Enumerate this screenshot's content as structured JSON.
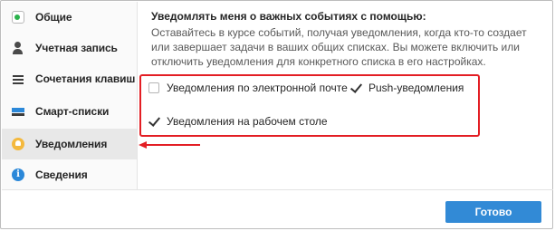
{
  "sidebar": {
    "items": [
      {
        "label": "Общие",
        "icon": "toggle-icon"
      },
      {
        "label": "Учетная запись",
        "icon": "user-icon"
      },
      {
        "label": "Сочетания клавиш",
        "icon": "keyboard-icon"
      },
      {
        "label": "Смарт-списки",
        "icon": "smart-list-icon"
      },
      {
        "label": "Уведомления",
        "icon": "bell-icon",
        "active": true
      },
      {
        "label": "Сведения",
        "icon": "info-icon"
      }
    ]
  },
  "main": {
    "title": "Уведомлять меня о важных событиях с помощью:",
    "description": "Оставайтесь в курсе событий, получая уведомления, когда кто-то создает или завершает задачи в ваших общих списках. Вы можете включить или отключить уведомления для конкретного списка в его настройках.",
    "options": [
      {
        "label": "Уведомления по электронной почте",
        "checked": false
      },
      {
        "label": "Push-уведомления",
        "checked": true
      },
      {
        "label": "Уведомления на рабочем столе",
        "checked": true
      }
    ]
  },
  "footer": {
    "done_label": "Готово"
  },
  "colors": {
    "accent": "#328ad6",
    "highlight_red": "#e31e24",
    "bell": "#f4b93e",
    "toggle_green": "#2bb24c"
  }
}
